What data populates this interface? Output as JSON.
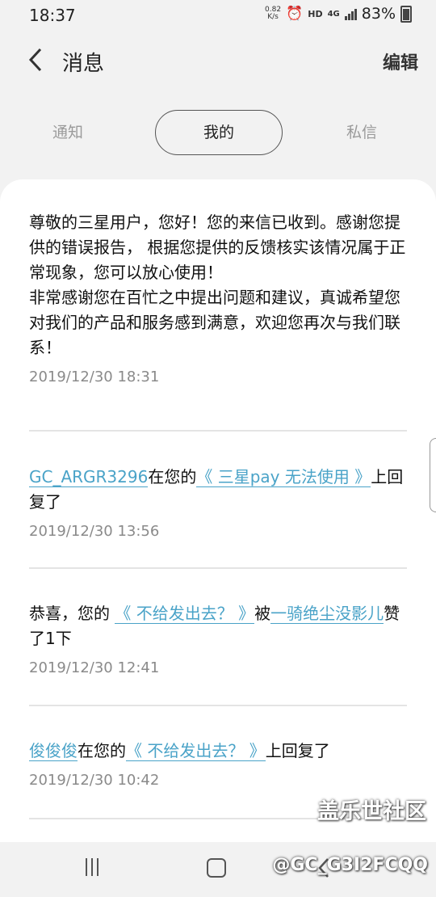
{
  "status_bar": {
    "time": "18:37",
    "net_speed_value": "0.82",
    "net_speed_unit": "K/s",
    "hd": "HD",
    "network": "4G",
    "battery": "83%"
  },
  "header": {
    "title": "消息",
    "edit_label": "编辑"
  },
  "tabs": [
    {
      "label": "通知"
    },
    {
      "label": "我的"
    },
    {
      "label": "私信"
    }
  ],
  "messages": [
    {
      "text": "尊敬的三星用户，您好！您的来信已收到。感谢您提供的错误报告， 根据您提供的反馈核实该情况属于正常现象，您可以放心使用！\n非常感谢您在百忙之中提出问题和建议，真诚希望您对我们的产品和服务感到满意，欢迎您再次与我们联系！",
      "time": "2019/12/30  18:31"
    },
    {
      "user": "GC_ARGR3296",
      "mid": "在您的",
      "post": "《 三星pay 无法使用 》",
      "suffix": "上回复了",
      "time": "2019/12/30  13:56"
    },
    {
      "prefix": "恭喜，您的 ",
      "post": "《 不给发出去？ 》",
      "mid": "被",
      "user": "一骑绝尘没影儿",
      "suffix": "赞了1下",
      "time": "2019/12/30  12:41"
    },
    {
      "user": "俊俊俊",
      "mid": "在您的",
      "post": "《 不给发出去？ 》",
      "suffix": "上回复了",
      "time": "2019/12/30  10:42"
    }
  ],
  "watermark": {
    "line1": "盖乐世社区",
    "line2": "@GC_G3I2FCQQ"
  }
}
